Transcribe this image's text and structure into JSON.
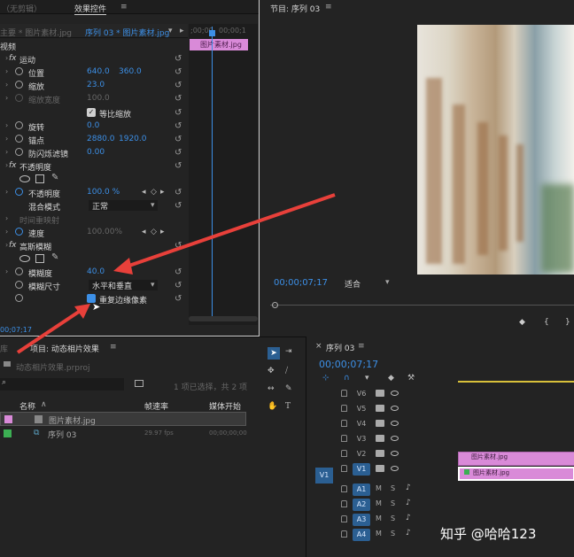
{
  "effect_controls": {
    "tab_source": "（无剪辑）",
    "tab_effect_controls": "效果控件",
    "menu_icon": "≡",
    "seq_path_left": "主要 * 图片素材.jpg",
    "seq_path_right": "序列 03 * 图片素材.jpg",
    "ruler_time": ";00;00",
    "ruler_time2": "00;00;1",
    "clip_label": "图片素材.jpg",
    "section_video": "视频",
    "motion": "运动",
    "position_label": "位置",
    "position_x": "640.0",
    "position_y": "360.0",
    "scale_label": "缩放",
    "scale_value": "23.0",
    "scale_width_label": "缩放宽度",
    "scale_width_value": "100.0",
    "uniform_scale": "等比缩放",
    "rotation_label": "旋转",
    "rotation_value": "0.0",
    "anchor_label": "锚点",
    "anchor_x": "2880.0",
    "anchor_y": "1920.0",
    "antiflicker_label": "防闪烁滤镜",
    "antiflicker_value": "0.00",
    "opacity_section": "不透明度",
    "opacity_label": "不透明度",
    "opacity_value": "100.0 %",
    "blend_label": "混合模式",
    "blend_value": "正常",
    "time_remap": "时间重映射",
    "speed_label": "速度",
    "speed_value": "100.00%",
    "gaussian_blur": "高斯模糊",
    "blurriness_label": "模糊度",
    "blurriness_value": "40.0",
    "blur_dim_label": "模糊尺寸",
    "blur_dim_value": "水平和垂直",
    "repeat_edge": "重复边缘像素",
    "bottom_time": "00;07;17"
  },
  "program": {
    "title": "节目: 序列 03",
    "menu_icon": "≡",
    "timecode": "00;00;07;17",
    "fit": "适合"
  },
  "project": {
    "left_tab": "库",
    "title": "项目: 动态相片效果",
    "menu_icon": "≡",
    "file": "动态相片效果.prproj",
    "selection_info": "1 项已选择，共 2 项",
    "col_name": "名称",
    "col_framerate": "帧速率",
    "col_media_start": "媒体开始",
    "items": [
      {
        "name": "图片素材.jpg",
        "fps": "",
        "start": ""
      },
      {
        "name": "序列 03",
        "fps": "29.97 fps",
        "start": "00;00;00;00"
      }
    ]
  },
  "timeline": {
    "title": "序列 03",
    "menu_icon": "≡",
    "timecode": "00;00;07;17",
    "tracks": [
      {
        "name": "V6",
        "type": "video"
      },
      {
        "name": "V5",
        "type": "video"
      },
      {
        "name": "V4",
        "type": "video"
      },
      {
        "name": "V3",
        "type": "video"
      },
      {
        "name": "V2",
        "type": "video"
      },
      {
        "name": "V1",
        "type": "video"
      },
      {
        "name": "A1",
        "type": "audio"
      },
      {
        "name": "A2",
        "type": "audio"
      },
      {
        "name": "A3",
        "type": "audio"
      },
      {
        "name": "A4",
        "type": "audio"
      }
    ],
    "source_v1": "V1",
    "clip_v2": "图片素材.jpg",
    "clip_v1": "图片素材.jpg"
  },
  "watermark": "知乎 @哈哈123",
  "colors": {
    "accent": "#3c8fe6",
    "clip": "#d98ad8",
    "arrow": "#e8403a"
  }
}
